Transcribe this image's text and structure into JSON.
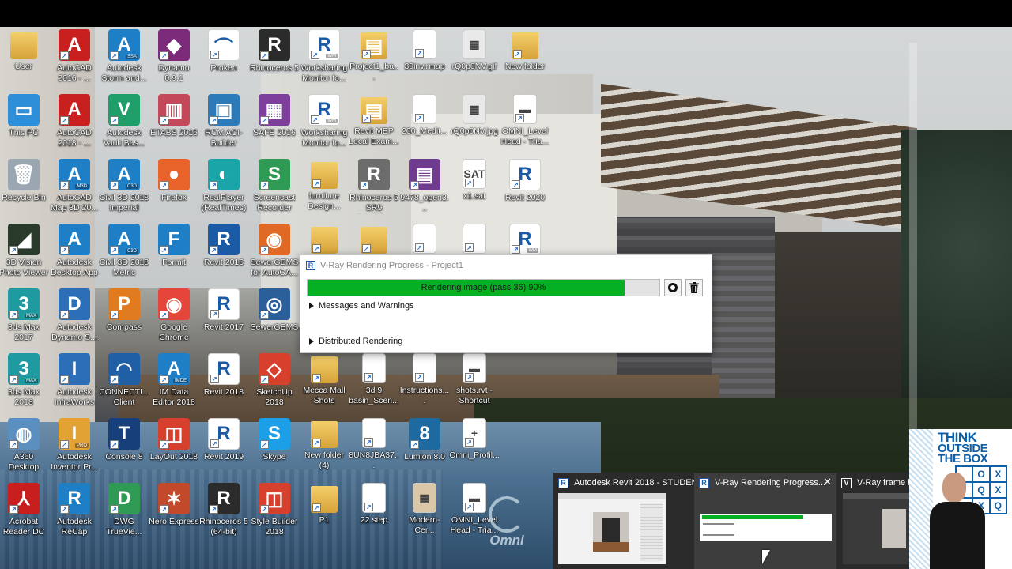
{
  "desktop": {
    "icons": [
      {
        "label": "User",
        "glyph": "",
        "color": "#d7a23a",
        "kind": "folder-user-icon",
        "arrow": false,
        "sub": ""
      },
      {
        "label": "AutoCAD 2016 - ...",
        "glyph": "A",
        "color": "#c8201e",
        "kind": "autocad-icon",
        "arrow": true,
        "sub": ""
      },
      {
        "label": "Autodesk Storm and...",
        "glyph": "A",
        "color": "#1e7fc7",
        "kind": "autodesk-ssa-icon",
        "arrow": true,
        "sub": "SSA"
      },
      {
        "label": "Dynamo 0.9.1",
        "glyph": "◆",
        "color": "#7c2a7a",
        "kind": "dynamo-icon",
        "arrow": true,
        "sub": ""
      },
      {
        "label": "Proken",
        "glyph": "⌒",
        "color": "#ffffff",
        "kind": "proken-icon",
        "arrow": true,
        "sub": ""
      },
      {
        "label": "Rhinoceros 5",
        "glyph": "R",
        "color": "#2b2b2b",
        "kind": "rhino-icon",
        "arrow": true,
        "sub": ""
      },
      {
        "label": "Worksharing Monitor fo...",
        "glyph": "R",
        "color": "#ffffff",
        "kind": "revit-wm-icon",
        "arrow": true,
        "sub": "WM"
      },
      {
        "label": "Project1_ba...",
        "glyph": "▤",
        "color": "#e8c040",
        "kind": "folder-file-icon",
        "arrow": true,
        "sub": ""
      },
      {
        "label": "30inv.rmap",
        "glyph": "",
        "color": "#ffffff",
        "kind": "file-icon",
        "arrow": true,
        "sub": ""
      },
      {
        "label": "rQ0p0NV.gif",
        "glyph": "▦",
        "color": "#e9e9e9",
        "kind": "image-file-icon",
        "arrow": false,
        "sub": ""
      },
      {
        "label": "New folder",
        "glyph": "",
        "color": "#d7a23a",
        "kind": "folder-icon",
        "arrow": true,
        "sub": ""
      },
      {
        "label": "This PC",
        "glyph": "▭",
        "color": "#2f8ed8",
        "kind": "computer-icon",
        "arrow": false,
        "sub": ""
      },
      {
        "label": "AutoCAD 2018 - ...",
        "glyph": "A",
        "color": "#c8201e",
        "kind": "autocad-icon",
        "arrow": true,
        "sub": ""
      },
      {
        "label": "Autodesk Vault Bas...",
        "glyph": "V",
        "color": "#1f9e6a",
        "kind": "vault-icon",
        "arrow": true,
        "sub": ""
      },
      {
        "label": "ETABS 2016",
        "glyph": "▥",
        "color": "#c2485a",
        "kind": "etabs-icon",
        "arrow": true,
        "sub": ""
      },
      {
        "label": "RCM ACI-Builder",
        "glyph": "▣",
        "color": "#2d7ab8",
        "kind": "rcm-icon",
        "arrow": true,
        "sub": ""
      },
      {
        "label": "SAFE 2016",
        "glyph": "▦",
        "color": "#7d3f9b",
        "kind": "safe-icon",
        "arrow": true,
        "sub": ""
      },
      {
        "label": "Worksharing Monitor fo...",
        "glyph": "R",
        "color": "#ffffff",
        "kind": "revit-wm-icon",
        "arrow": true,
        "sub": "WM"
      },
      {
        "label": "Revit MEP Local Exam...",
        "glyph": "▤",
        "color": "#e8c040",
        "kind": "folder-file-icon",
        "arrow": true,
        "sub": ""
      },
      {
        "label": "200_Medit...",
        "glyph": "",
        "color": "#ffffff",
        "kind": "file-icon",
        "arrow": true,
        "sub": ""
      },
      {
        "label": "rQ0p0NV.jpg",
        "glyph": "▦",
        "color": "#e9e9e9",
        "kind": "image-file-icon",
        "arrow": false,
        "sub": ""
      },
      {
        "label": "OMNI_Level Head - Tria...",
        "glyph": "▬",
        "color": "#ffffff",
        "kind": "family-file-icon",
        "arrow": true,
        "sub": ""
      },
      {
        "label": "Recycle Bin",
        "glyph": "🗑",
        "color": "#9aa7b3",
        "kind": "recycle-bin-icon",
        "arrow": false,
        "sub": ""
      },
      {
        "label": "AutoCAD Map 3D 20...",
        "glyph": "A",
        "color": "#1e7fc7",
        "kind": "autocad-map-icon",
        "arrow": true,
        "sub": "M3D"
      },
      {
        "label": "Civil 3D 2018 Imperial",
        "glyph": "A",
        "color": "#1e7fc7",
        "kind": "civil3d-icon",
        "arrow": true,
        "sub": "C3D"
      },
      {
        "label": "Firefox",
        "glyph": "●",
        "color": "#e8632a",
        "kind": "firefox-icon",
        "arrow": true,
        "sub": ""
      },
      {
        "label": "RealPlayer (RealTimes)",
        "glyph": "◐",
        "color": "#1aa5a8",
        "kind": "realplayer-icon",
        "arrow": true,
        "sub": ""
      },
      {
        "label": "Screencast Recorder",
        "glyph": "S",
        "color": "#2f9a54",
        "kind": "screencast-icon",
        "arrow": true,
        "sub": ""
      },
      {
        "label": "furniture Design...",
        "glyph": "",
        "color": "#d7a23a",
        "kind": "folder-icon",
        "arrow": true,
        "sub": ""
      },
      {
        "label": "Rhinoceros 5 SR9 5.9.406...",
        "glyph": "R",
        "color": "#6c6c6c",
        "kind": "rhino-installer-icon",
        "arrow": true,
        "sub": ""
      },
      {
        "label": "9478_open3...",
        "glyph": "▤",
        "color": "#6e3b8f",
        "kind": "winrar-icon",
        "arrow": true,
        "sub": ""
      },
      {
        "label": "x1.sat",
        "glyph": "SAT",
        "color": "#ffffff",
        "kind": "sat-file-icon",
        "arrow": true,
        "sub": ""
      },
      {
        "label": "Revit 2020",
        "glyph": "R",
        "color": "#ffffff",
        "kind": "revit-icon",
        "arrow": true,
        "sub": ""
      },
      {
        "label": "3D Vision Photo Viewer",
        "glyph": "◢",
        "color": "#2a3a2a",
        "kind": "3d-vision-icon",
        "arrow": true,
        "sub": ""
      },
      {
        "label": "Autodesk Desktop App",
        "glyph": "A",
        "color": "#1e7fc7",
        "kind": "autodesk-app-icon",
        "arrow": true,
        "sub": ""
      },
      {
        "label": "Civil 3D 2018 Metric",
        "glyph": "A",
        "color": "#1e7fc7",
        "kind": "civil3d-icon",
        "arrow": true,
        "sub": "C3D"
      },
      {
        "label": "Formit",
        "glyph": "F",
        "color": "#1e7fc7",
        "kind": "formit-icon",
        "arrow": true,
        "sub": ""
      },
      {
        "label": "Revit 2016",
        "glyph": "R",
        "color": "#1b5aa5",
        "kind": "revit-icon",
        "arrow": true,
        "sub": ""
      },
      {
        "label": "SewerGEMS for AutoCA...",
        "glyph": "◉",
        "color": "#e06a25",
        "kind": "sewergems-icon",
        "arrow": true,
        "sub": ""
      },
      {
        "label": "",
        "glyph": "",
        "color": "#d7a23a",
        "kind": "folder-icon",
        "arrow": true,
        "sub": ""
      },
      {
        "label": "",
        "glyph": "",
        "color": "#e8c040",
        "kind": "folder-icon",
        "arrow": true,
        "sub": ""
      },
      {
        "label": "",
        "glyph": "",
        "color": "#ffffff",
        "kind": "file-icon",
        "arrow": true,
        "sub": ""
      },
      {
        "label": "",
        "glyph": "",
        "color": "#ffffff",
        "kind": "file-icon",
        "arrow": true,
        "sub": ""
      },
      {
        "label": "",
        "glyph": "R",
        "color": "#ffffff",
        "kind": "revit-wm-icon",
        "arrow": true,
        "sub": "WM"
      },
      {
        "label": "3ds Max 2017",
        "glyph": "3",
        "color": "#1f9aa0",
        "kind": "3dsmax-icon",
        "arrow": true,
        "sub": "MAX"
      },
      {
        "label": "Autodesk Dynamo S...",
        "glyph": "D",
        "color": "#2c6fb8",
        "kind": "dynamo-studio-icon",
        "arrow": true,
        "sub": ""
      },
      {
        "label": "Compass",
        "glyph": "P",
        "color": "#e07b1f",
        "kind": "compass-icon",
        "arrow": true,
        "sub": ""
      },
      {
        "label": "Google Chrome",
        "glyph": "◉",
        "color": "#e6453a",
        "kind": "chrome-icon",
        "arrow": true,
        "sub": ""
      },
      {
        "label": "Revit 2017",
        "glyph": "R",
        "color": "#ffffff",
        "kind": "revit-icon",
        "arrow": true,
        "sub": ""
      },
      {
        "label": "SewerGEMS",
        "glyph": "◎",
        "color": "#2b5f99",
        "kind": "sewergems-icon",
        "arrow": true,
        "sub": ""
      },
      {
        "label": "3ds Max 2018",
        "glyph": "3",
        "color": "#1f9aa0",
        "kind": "3dsmax-icon",
        "arrow": true,
        "sub": "MAX"
      },
      {
        "label": "Autodesk InfraWorks",
        "glyph": "I",
        "color": "#2c6fb8",
        "kind": "infraworks-icon",
        "arrow": true,
        "sub": ""
      },
      {
        "label": "CONNECTI... Client",
        "glyph": "◠",
        "color": "#1e5fa5",
        "kind": "connect-icon",
        "arrow": true,
        "sub": ""
      },
      {
        "label": "IM Data Editor 2018",
        "glyph": "A",
        "color": "#1e7fc7",
        "kind": "im-data-icon",
        "arrow": true,
        "sub": "IMDE"
      },
      {
        "label": "Revit 2018",
        "glyph": "R",
        "color": "#ffffff",
        "kind": "revit-icon",
        "arrow": true,
        "sub": ""
      },
      {
        "label": "SketchUp 2018",
        "glyph": "◇",
        "color": "#d8402e",
        "kind": "sketchup-icon",
        "arrow": true,
        "sub": ""
      },
      {
        "label": "Mecca Mall Shots",
        "glyph": "",
        "color": "#d7a23a",
        "kind": "folder-icon",
        "arrow": true,
        "sub": ""
      },
      {
        "label": "3d 9 basin_Scen...",
        "glyph": "",
        "color": "#ffffff",
        "kind": "file-icon",
        "arrow": true,
        "sub": ""
      },
      {
        "label": "Instructions....",
        "glyph": "",
        "color": "#ffffff",
        "kind": "file-icon",
        "arrow": true,
        "sub": ""
      },
      {
        "label": "shots.rvt - Shortcut",
        "glyph": "▬",
        "color": "#ffffff",
        "kind": "shortcut-icon",
        "arrow": true,
        "sub": ""
      },
      {
        "label": "A360 Desktop",
        "glyph": "◍",
        "color": "#5b8fc0",
        "kind": "a360-icon",
        "arrow": true,
        "sub": ""
      },
      {
        "label": "Autodesk Inventor Pr...",
        "glyph": "I",
        "color": "#e2a234",
        "kind": "inventor-icon",
        "arrow": true,
        "sub": "PRO"
      },
      {
        "label": "Console 8",
        "glyph": "T",
        "color": "#173f7a",
        "kind": "console-icon",
        "arrow": true,
        "sub": ""
      },
      {
        "label": "LayOut 2018",
        "glyph": "◫",
        "color": "#d8402e",
        "kind": "layout-icon",
        "arrow": true,
        "sub": ""
      },
      {
        "label": "Revit 2019",
        "glyph": "R",
        "color": "#ffffff",
        "kind": "revit-icon",
        "arrow": true,
        "sub": ""
      },
      {
        "label": "Skype",
        "glyph": "S",
        "color": "#1c9fe6",
        "kind": "skype-icon",
        "arrow": true,
        "sub": ""
      },
      {
        "label": "New folder (4)",
        "glyph": "",
        "color": "#d7a23a",
        "kind": "folder-icon",
        "arrow": true,
        "sub": ""
      },
      {
        "label": "8UN8JBA37...",
        "glyph": "",
        "color": "#ffffff",
        "kind": "file-icon",
        "arrow": true,
        "sub": ""
      },
      {
        "label": "Lumion 8.0",
        "glyph": "8",
        "color": "#1d6aa0",
        "kind": "lumion-icon",
        "arrow": true,
        "sub": ""
      },
      {
        "label": "Omni_Profil...",
        "glyph": "+",
        "color": "#ffffff",
        "kind": "family-file-icon",
        "arrow": true,
        "sub": ""
      },
      {
        "label": "Acrobat Reader DC",
        "glyph": "⅄",
        "color": "#c81e1e",
        "kind": "acrobat-icon",
        "arrow": true,
        "sub": ""
      },
      {
        "label": "Autodesk ReCap",
        "glyph": "R",
        "color": "#1e7fc7",
        "kind": "recap-icon",
        "arrow": true,
        "sub": ""
      },
      {
        "label": "DWG TrueVie...",
        "glyph": "D",
        "color": "#2f9a54",
        "kind": "dwg-trueview-icon",
        "arrow": true,
        "sub": ""
      },
      {
        "label": "Nero Express",
        "glyph": "✶",
        "color": "#c24a2a",
        "kind": "nero-icon",
        "arrow": true,
        "sub": ""
      },
      {
        "label": "Rhinoceros 5 (64-bit)",
        "glyph": "R",
        "color": "#2b2b2b",
        "kind": "rhino-icon",
        "arrow": true,
        "sub": ""
      },
      {
        "label": "Style Builder 2018",
        "glyph": "◫",
        "color": "#d8402e",
        "kind": "style-builder-icon",
        "arrow": true,
        "sub": ""
      },
      {
        "label": "P1",
        "glyph": "",
        "color": "#d7a23a",
        "kind": "folder-icon",
        "arrow": true,
        "sub": ""
      },
      {
        "label": "22.step",
        "glyph": "",
        "color": "#ffffff",
        "kind": "file-icon",
        "arrow": true,
        "sub": ""
      },
      {
        "label": "Modern-Cer...",
        "glyph": "▦",
        "color": "#d9c7a8",
        "kind": "image-file-icon",
        "arrow": false,
        "sub": ""
      },
      {
        "label": "OMNI_Level Head - Tria...",
        "glyph": "▬",
        "color": "#ffffff",
        "kind": "family-file-icon",
        "arrow": true,
        "sub": ""
      }
    ]
  },
  "vray": {
    "title": "V-Ray Rendering Progress - Project1",
    "icon_letter": "R",
    "progress_text": "Rendering image (pass 36) 90%",
    "progress_fraction": 0.9,
    "progress_color": "#06b025",
    "sections": [
      "Messages and Warnings",
      "Distributed Rendering"
    ]
  },
  "taskbar_previews": [
    {
      "title": "Autodesk Revit 2018 - STUDEN...",
      "icon_letter": "R"
    },
    {
      "title": "V-Ray Rendering Progress...",
      "icon_letter": "R",
      "close": "✕"
    },
    {
      "title": "V-Ray frame b",
      "icon_letter": "V"
    }
  ],
  "webcam": {
    "line1": "THINK",
    "line2": "OUTSIDE",
    "line3": "THE BOX",
    "grid": [
      "",
      "O",
      "X",
      "",
      "Q",
      "X",
      "",
      "X",
      "Q"
    ]
  },
  "watermark": {
    "text": "Omni"
  }
}
